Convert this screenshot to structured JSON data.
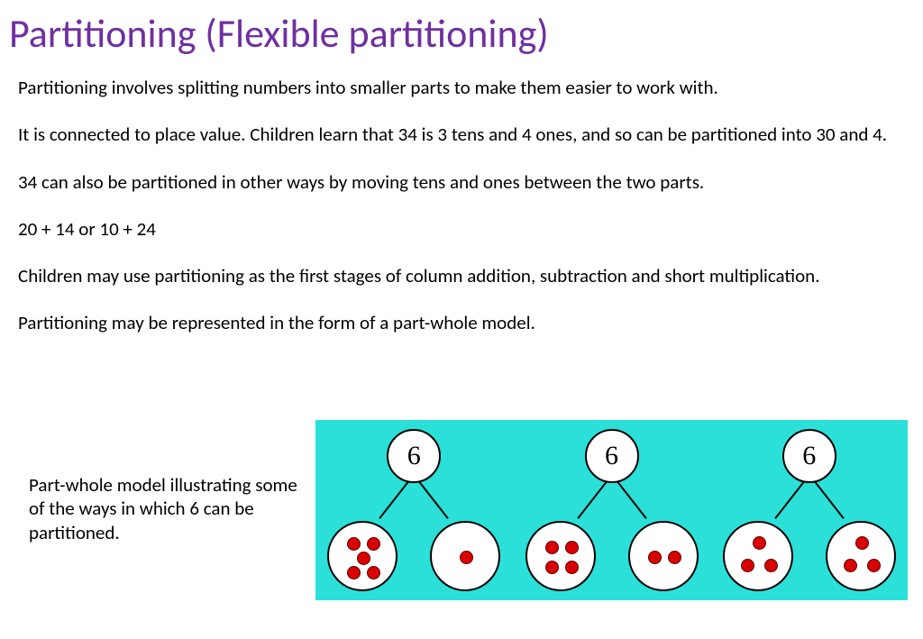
{
  "title": "Partitioning (Flexible partitioning)",
  "paragraphs": {
    "p1": "Partitioning involves splitting numbers into smaller parts to make them easier to work with.",
    "p2": "It is connected to place value. Children learn that 34 is 3 tens and 4 ones, and so can be partitioned into 30 and 4.",
    "p3": "34 can also be partitioned in other ways by moving tens and ones between the two parts.",
    "p4": "20 + 14 or 10 + 24",
    "p5": "Children may use partitioning as the first stages of column addition, subtraction and short multiplication.",
    "p6": "Partitioning may be represented in the form of a part-whole model."
  },
  "caption": "Part-whole model illustrating some of the ways in which 6 can be partitioned.",
  "diagram": {
    "whole": "6",
    "models": [
      {
        "left_dots": 5,
        "right_dots": 1
      },
      {
        "left_dots": 4,
        "right_dots": 2
      },
      {
        "left_dots": 3,
        "right_dots": 3
      }
    ]
  }
}
